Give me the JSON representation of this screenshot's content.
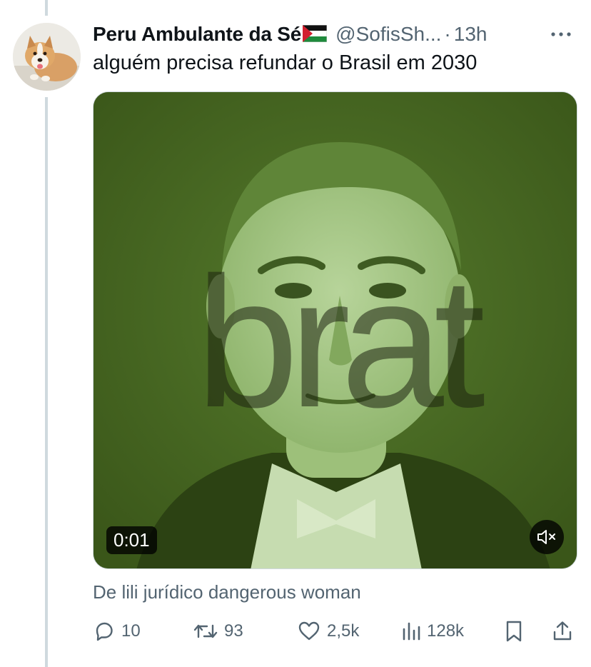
{
  "tweet": {
    "display_name": "Peru Ambulante da Sé",
    "handle": "@SofisSh...",
    "separator": "·",
    "time": "13h",
    "text": "alguém precisa refundar o Brasil em 2030",
    "media": {
      "type": "video",
      "overlay_text": "brat",
      "duration": "0:01",
      "muted": true
    },
    "attribution": "De lili jurídico dangerous woman",
    "actions": {
      "replies": "10",
      "reposts": "93",
      "likes": "2,5k",
      "views": "128k"
    }
  },
  "icons": {
    "flag": "palestine-flag-icon",
    "more": "more-horizontal-icon",
    "reply": "reply-icon",
    "repost": "repost-icon",
    "like": "heart-icon",
    "views": "views-icon",
    "bookmark": "bookmark-icon",
    "share": "share-icon",
    "mute": "volume-muted-icon"
  },
  "colors": {
    "text_primary": "#0f1419",
    "text_secondary": "#536471",
    "thread_line": "#cfd9de",
    "video_tint": "#8ab15e"
  }
}
